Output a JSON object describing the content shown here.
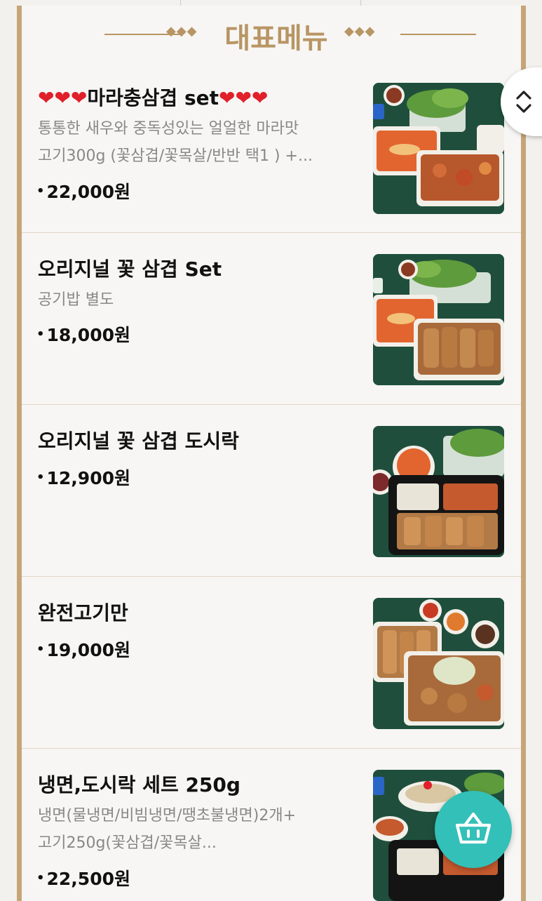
{
  "section_title": "대표메뉴",
  "header": {
    "ornament_left": "◆◆◆",
    "ornament_right": "◆◆◆"
  },
  "menu": [
    {
      "name_prefix": "❤❤❤",
      "name": "마라충삼겹 set",
      "name_suffix": "❤❤❤",
      "desc_line1": "통통한 새우와 중독성있는 얼얼한 마라맛",
      "desc_line2": "고기300g (꽃삼겹/꽃목살/반반 택1 ) +...",
      "price": "22,000원",
      "image_icon": "food-photo-mala-set"
    },
    {
      "name": "오리지널 꽃 삼겹 Set",
      "desc_line1": "공기밥 별도",
      "price": "18,000원",
      "image_icon": "food-photo-original-set"
    },
    {
      "name": "오리지널 꽃 삼겹 도시락",
      "price": "12,900원",
      "image_icon": "food-photo-lunchbox"
    },
    {
      "name": "완전고기만",
      "price": "19,000원",
      "image_icon": "food-photo-meat-only"
    },
    {
      "name": "냉면,도시락 세트 250g",
      "desc_line1": "냉면(물냉면/비빔냉면/땡초불냉면)2개+",
      "desc_line2": "고기250g(꽃삼겹/꽃목살...",
      "price": "22,500원",
      "image_icon": "food-photo-naengmyeon-set"
    }
  ],
  "colors": {
    "accent_gold": "#b89564",
    "border_gold": "#c6a578",
    "fab_teal": "#33c0b8",
    "heart_red": "#e0202a"
  }
}
